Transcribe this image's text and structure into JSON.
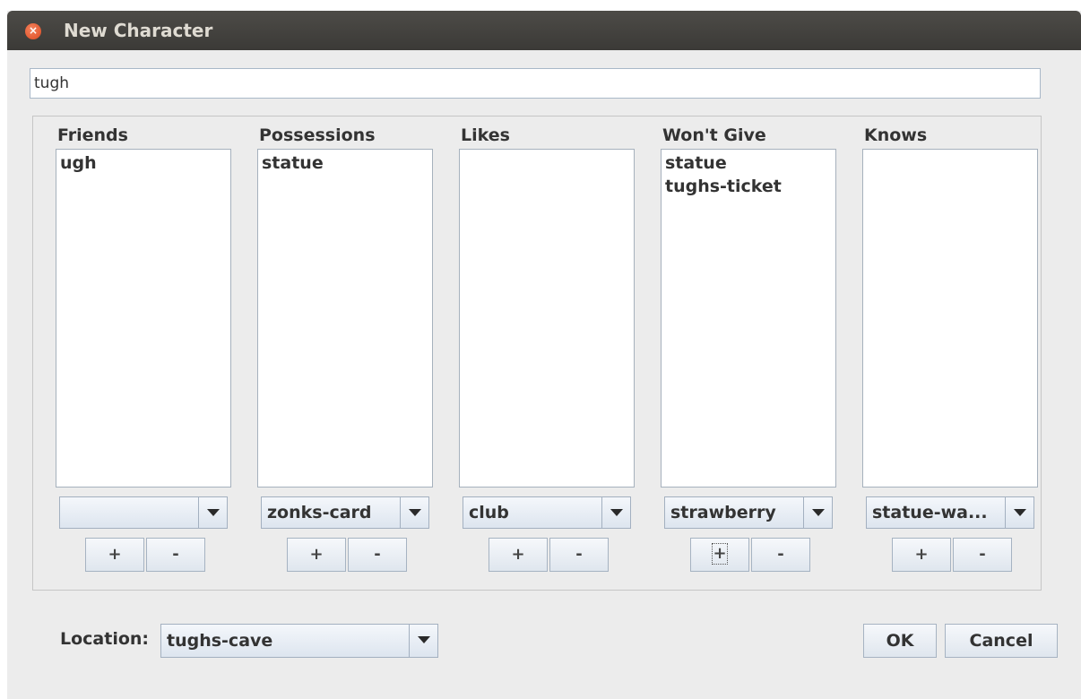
{
  "window": {
    "title": "New Character",
    "close_icon": "x-icon"
  },
  "name_field": {
    "value": "tugh"
  },
  "columns": [
    {
      "header": "Friends",
      "items": [
        "ugh"
      ],
      "combo_value": "",
      "add_label": "+",
      "remove_label": "-"
    },
    {
      "header": "Possessions",
      "items": [
        "statue"
      ],
      "combo_value": "zonks-card",
      "add_label": "+",
      "remove_label": "-"
    },
    {
      "header": "Likes",
      "items": [],
      "combo_value": "club",
      "add_label": "+",
      "remove_label": "-"
    },
    {
      "header": "Won't Give",
      "items": [
        "statue",
        "tughs-ticket"
      ],
      "combo_value": "strawberry",
      "add_label": "+",
      "remove_label": "-"
    },
    {
      "header": "Knows",
      "items": [],
      "combo_value": "statue-wa...",
      "add_label": "+",
      "remove_label": "-"
    }
  ],
  "location": {
    "label": "Location:",
    "value": "tughs-cave"
  },
  "buttons": {
    "ok": "OK",
    "cancel": "Cancel"
  },
  "colors": {
    "titlebar": "#3c3b37",
    "close_button": "#e05a2b",
    "window_bg": "#ececec"
  }
}
